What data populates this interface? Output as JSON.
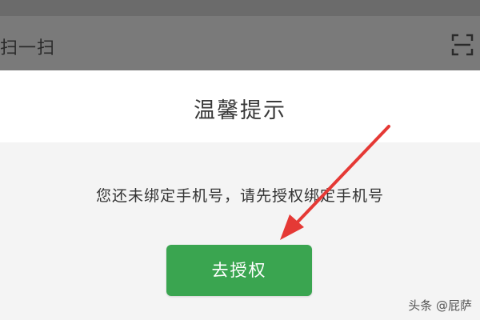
{
  "header": {
    "title": "扫一扫",
    "scan_icon": "scan-frame-icon"
  },
  "dialog": {
    "title": "温馨提示",
    "message": "您还未绑定手机号，请先授权绑定手机号",
    "button_label": "去授权"
  },
  "watermark": "头条 @屁萨",
  "colors": {
    "button": "#3aa550",
    "arrow": "#e53935",
    "header_overlay": "#7a7a7a"
  }
}
